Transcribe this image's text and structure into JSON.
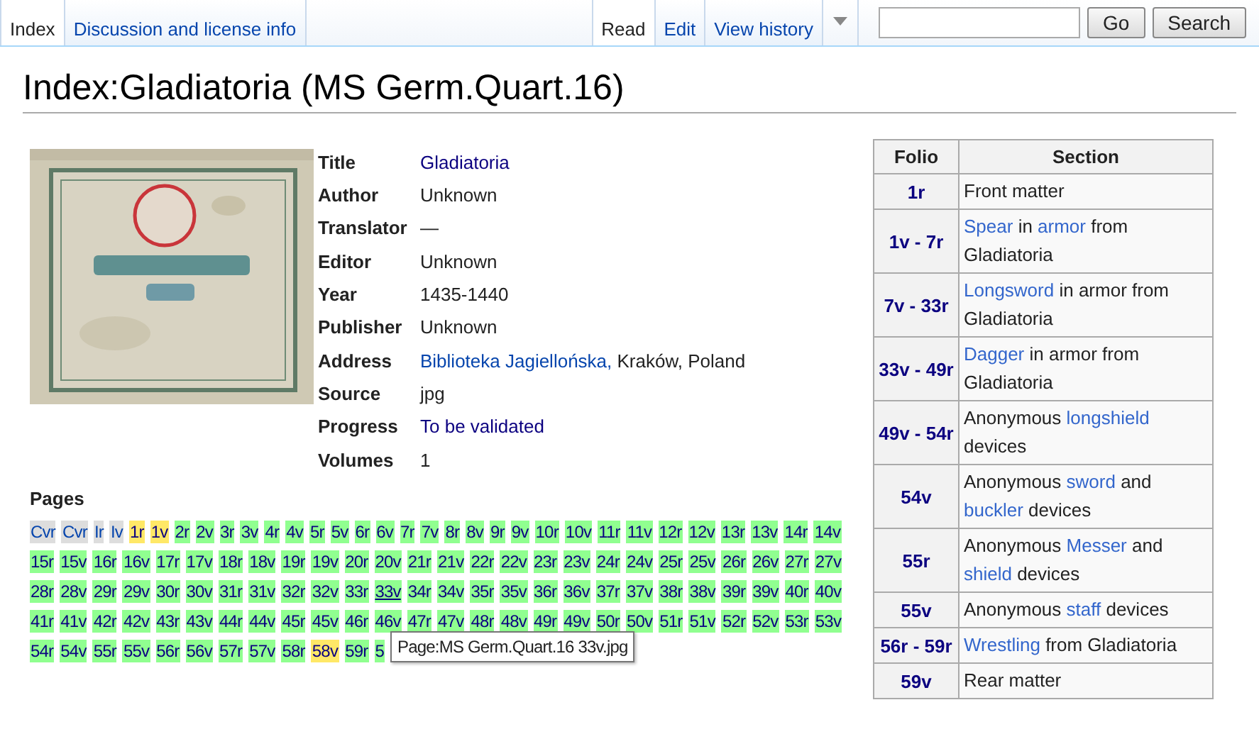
{
  "tabs_left": [
    {
      "label": "Index",
      "selected": true
    },
    {
      "label": "Discussion and license info",
      "selected": false
    }
  ],
  "tabs_right": [
    {
      "label": "Read",
      "selected": true
    },
    {
      "label": "Edit",
      "selected": false
    },
    {
      "label": "View history",
      "selected": false
    }
  ],
  "search": {
    "go": "Go",
    "search": "Search"
  },
  "title": "Index:Gladiatoria (MS Germ.Quart.16)",
  "fields": [
    {
      "label": "Title",
      "value": "Gladiatoria",
      "link": true
    },
    {
      "label": "Author",
      "value": "Unknown",
      "link": false
    },
    {
      "label": "Translator",
      "value": "—",
      "link": false
    },
    {
      "label": "Editor",
      "value": "Unknown",
      "link": false
    },
    {
      "label": "Year",
      "value": "1435-1440",
      "link": false
    },
    {
      "label": "Publisher",
      "value": "Unknown",
      "link": false
    },
    {
      "label": "Address",
      "value": [
        {
          "text": "Biblioteka Jagiellońska,",
          "link": true
        },
        {
          "text": " Kraków, Poland",
          "link": false
        }
      ]
    },
    {
      "label": "Source",
      "value": "jpg",
      "link": false
    },
    {
      "label": "Progress",
      "value": "To be validated",
      "link": true
    },
    {
      "label": "Volumes",
      "value": "1",
      "link": false
    }
  ],
  "pages_heading": "Pages",
  "pages": [
    {
      "label": "Cvr",
      "color": "#dddddd",
      "underlined": false
    },
    {
      "label": "Cvr",
      "color": "#dddddd",
      "underlined": false
    },
    {
      "label": "Ir",
      "color": "#dddddd",
      "underlined": false
    },
    {
      "label": "Iv",
      "color": "#dddddd",
      "underlined": false
    },
    {
      "label": "1r",
      "color": "#ffe867",
      "underlined": false
    },
    {
      "label": "1v",
      "color": "#ffe867",
      "underlined": false
    },
    {
      "label": "2r",
      "color": "#90ff90",
      "underlined": false
    },
    {
      "label": "2v",
      "color": "#90ff90",
      "underlined": false
    },
    {
      "label": "3r",
      "color": "#90ff90",
      "underlined": false
    },
    {
      "label": "3v",
      "color": "#90ff90",
      "underlined": false
    },
    {
      "label": "4r",
      "color": "#90ff90",
      "underlined": false
    },
    {
      "label": "4v",
      "color": "#90ff90",
      "underlined": false
    },
    {
      "label": "5r",
      "color": "#90ff90",
      "underlined": false
    },
    {
      "label": "5v",
      "color": "#90ff90",
      "underlined": false
    },
    {
      "label": "6r",
      "color": "#90ff90",
      "underlined": false
    },
    {
      "label": "6v",
      "color": "#90ff90",
      "underlined": false
    },
    {
      "label": "7r",
      "color": "#90ff90",
      "underlined": false
    },
    {
      "label": "7v",
      "color": "#90ff90",
      "underlined": false
    },
    {
      "label": "8r",
      "color": "#90ff90",
      "underlined": false
    },
    {
      "label": "8v",
      "color": "#90ff90",
      "underlined": false
    },
    {
      "label": "9r",
      "color": "#90ff90",
      "underlined": false
    },
    {
      "label": "9v",
      "color": "#90ff90",
      "underlined": false
    },
    {
      "label": "10r",
      "color": "#90ff90",
      "underlined": false
    },
    {
      "label": "10v",
      "color": "#90ff90",
      "underlined": false
    },
    {
      "label": "11r",
      "color": "#90ff90",
      "underlined": false
    },
    {
      "label": "11v",
      "color": "#90ff90",
      "underlined": false
    },
    {
      "label": "12r",
      "color": "#90ff90",
      "underlined": false
    },
    {
      "label": "12v",
      "color": "#90ff90",
      "underlined": false
    },
    {
      "label": "13r",
      "color": "#90ff90",
      "underlined": false
    },
    {
      "label": "13v",
      "color": "#90ff90",
      "underlined": false
    },
    {
      "label": "14r",
      "color": "#90ff90",
      "underlined": false
    },
    {
      "label": "14v",
      "color": "#90ff90",
      "underlined": false
    },
    {
      "label": "15r",
      "color": "#90ff90",
      "underlined": false
    },
    {
      "label": "15v",
      "color": "#90ff90",
      "underlined": false
    },
    {
      "label": "16r",
      "color": "#90ff90",
      "underlined": false
    },
    {
      "label": "16v",
      "color": "#90ff90",
      "underlined": false
    },
    {
      "label": "17r",
      "color": "#90ff90",
      "underlined": false
    },
    {
      "label": "17v",
      "color": "#90ff90",
      "underlined": false
    },
    {
      "label": "18r",
      "color": "#90ff90",
      "underlined": false
    },
    {
      "label": "18v",
      "color": "#90ff90",
      "underlined": false
    },
    {
      "label": "19r",
      "color": "#90ff90",
      "underlined": false
    },
    {
      "label": "19v",
      "color": "#90ff90",
      "underlined": false
    },
    {
      "label": "20r",
      "color": "#90ff90",
      "underlined": false
    },
    {
      "label": "20v",
      "color": "#90ff90",
      "underlined": false
    },
    {
      "label": "21r",
      "color": "#90ff90",
      "underlined": false
    },
    {
      "label": "21v",
      "color": "#90ff90",
      "underlined": false
    },
    {
      "label": "22r",
      "color": "#90ff90",
      "underlined": false
    },
    {
      "label": "22v",
      "color": "#90ff90",
      "underlined": false
    },
    {
      "label": "23r",
      "color": "#90ff90",
      "underlined": false
    },
    {
      "label": "23v",
      "color": "#90ff90",
      "underlined": false
    },
    {
      "label": "24r",
      "color": "#90ff90",
      "underlined": false
    },
    {
      "label": "24v",
      "color": "#90ff90",
      "underlined": false
    },
    {
      "label": "25r",
      "color": "#90ff90",
      "underlined": false
    },
    {
      "label": "25v",
      "color": "#90ff90",
      "underlined": false
    },
    {
      "label": "26r",
      "color": "#90ff90",
      "underlined": false
    },
    {
      "label": "26v",
      "color": "#90ff90",
      "underlined": false
    },
    {
      "label": "27r",
      "color": "#90ff90",
      "underlined": false
    },
    {
      "label": "27v",
      "color": "#90ff90",
      "underlined": false
    },
    {
      "label": "28r",
      "color": "#90ff90",
      "underlined": false
    },
    {
      "label": "28v",
      "color": "#90ff90",
      "underlined": false
    },
    {
      "label": "29r",
      "color": "#90ff90",
      "underlined": false
    },
    {
      "label": "29v",
      "color": "#90ff90",
      "underlined": false
    },
    {
      "label": "30r",
      "color": "#90ff90",
      "underlined": false
    },
    {
      "label": "30v",
      "color": "#90ff90",
      "underlined": false
    },
    {
      "label": "31r",
      "color": "#90ff90",
      "underlined": false
    },
    {
      "label": "31v",
      "color": "#90ff90",
      "underlined": false
    },
    {
      "label": "32r",
      "color": "#90ff90",
      "underlined": false
    },
    {
      "label": "32v",
      "color": "#90ff90",
      "underlined": false
    },
    {
      "label": "33r",
      "color": "#90ff90",
      "underlined": false
    },
    {
      "label": "33v",
      "color": "#90ff90",
      "underlined": true
    },
    {
      "label": "34r",
      "color": "#90ff90",
      "underlined": false
    },
    {
      "label": "34v",
      "color": "#90ff90",
      "underlined": false
    },
    {
      "label": "35r",
      "color": "#90ff90",
      "underlined": false
    },
    {
      "label": "35v",
      "color": "#90ff90",
      "underlined": false
    },
    {
      "label": "36r",
      "color": "#90ff90",
      "underlined": false
    },
    {
      "label": "36v",
      "color": "#90ff90",
      "underlined": false
    },
    {
      "label": "37r",
      "color": "#90ff90",
      "underlined": false
    },
    {
      "label": "37v",
      "color": "#90ff90",
      "underlined": false
    },
    {
      "label": "38r",
      "color": "#90ff90",
      "underlined": false
    },
    {
      "label": "38v",
      "color": "#90ff90",
      "underlined": false
    },
    {
      "label": "39r",
      "color": "#90ff90",
      "underlined": false
    },
    {
      "label": "39v",
      "color": "#90ff90",
      "underlined": false
    },
    {
      "label": "40r",
      "color": "#90ff90",
      "underlined": false
    },
    {
      "label": "40v",
      "color": "#90ff90",
      "underlined": false
    },
    {
      "label": "41r",
      "color": "#90ff90",
      "underlined": false
    },
    {
      "label": "41v",
      "color": "#90ff90",
      "underlined": false
    },
    {
      "label": "42r",
      "color": "#90ff90",
      "underlined": false
    },
    {
      "label": "42v",
      "color": "#90ff90",
      "underlined": false
    },
    {
      "label": "43r",
      "color": "#90ff90",
      "underlined": false
    },
    {
      "label": "43v",
      "color": "#90ff90",
      "underlined": false
    },
    {
      "label": "44r",
      "color": "#90ff90",
      "underlined": false
    },
    {
      "label": "44v",
      "color": "#90ff90",
      "underlined": false
    },
    {
      "label": "45r",
      "color": "#90ff90",
      "underlined": false
    },
    {
      "label": "45v",
      "color": "#90ff90",
      "underlined": false
    },
    {
      "label": "46r",
      "color": "#90ff90",
      "underlined": false
    },
    {
      "label": "46v",
      "color": "#90ff90",
      "underlined": false
    },
    {
      "label": "47r",
      "color": "#90ff90",
      "underlined": false
    },
    {
      "label": "47v",
      "color": "#90ff90",
      "underlined": false
    },
    {
      "label": "48r",
      "color": "#90ff90",
      "underlined": false
    },
    {
      "label": "48v",
      "color": "#90ff90",
      "underlined": false
    },
    {
      "label": "49r",
      "color": "#90ff90",
      "underlined": false
    },
    {
      "label": "49v",
      "color": "#90ff90",
      "underlined": false
    },
    {
      "label": "50r",
      "color": "#90ff90",
      "underlined": false
    },
    {
      "label": "50v",
      "color": "#90ff90",
      "underlined": false
    },
    {
      "label": "51r",
      "color": "#90ff90",
      "underlined": false
    },
    {
      "label": "51v",
      "color": "#90ff90",
      "underlined": false
    },
    {
      "label": "52r",
      "color": "#90ff90",
      "underlined": false
    },
    {
      "label": "52v",
      "color": "#90ff90",
      "underlined": false
    },
    {
      "label": "53r",
      "color": "#90ff90",
      "underlined": false
    },
    {
      "label": "53v",
      "color": "#90ff90",
      "underlined": false
    },
    {
      "label": "54r",
      "color": "#90ff90",
      "underlined": false
    },
    {
      "label": "54v",
      "color": "#90ff90",
      "underlined": false
    },
    {
      "label": "55r",
      "color": "#90ff90",
      "underlined": false
    },
    {
      "label": "55v",
      "color": "#90ff90",
      "underlined": false
    },
    {
      "label": "56r",
      "color": "#90ff90",
      "underlined": false
    },
    {
      "label": "56v",
      "color": "#90ff90",
      "underlined": false
    },
    {
      "label": "57r",
      "color": "#90ff90",
      "underlined": false
    },
    {
      "label": "57v",
      "color": "#90ff90",
      "underlined": false
    },
    {
      "label": "58r",
      "color": "#90ff90",
      "underlined": false
    },
    {
      "label": "58v",
      "color": "#ffe867",
      "underlined": false
    },
    {
      "label": "59r",
      "color": "#90ff90",
      "underlined": false
    },
    {
      "label": "5",
      "color": "#90ff90",
      "underlined": false
    }
  ],
  "tooltip": "Page:MS Germ.Quart.16 33v.jpg",
  "folio_table": {
    "columns": [
      "Folio",
      "Section"
    ],
    "rows": [
      {
        "folio": "1r",
        "section": [
          {
            "text": "Front matter",
            "link": false
          }
        ]
      },
      {
        "folio": "1v - 7r",
        "section": [
          {
            "text": "Spear",
            "link": true
          },
          {
            "text": " in ",
            "link": false
          },
          {
            "text": "armor",
            "link": true
          },
          {
            "text": " from Gladiatoria",
            "link": false
          }
        ]
      },
      {
        "folio": "7v - 33r",
        "section": [
          {
            "text": "Longsword",
            "link": true
          },
          {
            "text": " in armor from Gladiatoria",
            "link": false
          }
        ]
      },
      {
        "folio": "33v - 49r",
        "section": [
          {
            "text": "Dagger",
            "link": true
          },
          {
            "text": " in armor from Gladiatoria",
            "link": false
          }
        ]
      },
      {
        "folio": "49v - 54r",
        "section": [
          {
            "text": "Anonymous ",
            "link": false
          },
          {
            "text": "longshield",
            "link": true
          },
          {
            "text": " devices",
            "link": false
          }
        ]
      },
      {
        "folio": "54v",
        "section": [
          {
            "text": "Anonymous ",
            "link": false
          },
          {
            "text": "sword",
            "link": true
          },
          {
            "text": " and ",
            "link": false
          },
          {
            "text": "buckler",
            "link": true
          },
          {
            "text": " devices",
            "link": false
          }
        ]
      },
      {
        "folio": "55r",
        "section": [
          {
            "text": "Anonymous ",
            "link": false
          },
          {
            "text": "Messer",
            "link": true
          },
          {
            "text": " and ",
            "link": false
          },
          {
            "text": "shield",
            "link": true
          },
          {
            "text": " devices",
            "link": false
          }
        ]
      },
      {
        "folio": "55v",
        "section": [
          {
            "text": "Anonymous ",
            "link": false
          },
          {
            "text": "staff",
            "link": true
          },
          {
            "text": " devices",
            "link": false
          }
        ]
      },
      {
        "folio": "56r - 59r",
        "section": [
          {
            "text": "Wrestling",
            "link": true
          },
          {
            "text": " from Gladiatoria",
            "link": false
          }
        ]
      },
      {
        "folio": "59v",
        "section": [
          {
            "text": "Rear matter",
            "link": false
          }
        ]
      }
    ]
  }
}
